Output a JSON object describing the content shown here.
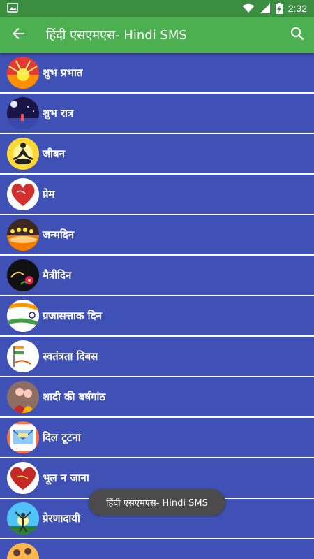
{
  "status_bar": {
    "time": "2:32",
    "icons": [
      "image-notification-icon",
      "wifi-icon",
      "signal-icon",
      "battery-charging-icon"
    ],
    "color": "#3b8e3f"
  },
  "app_bar": {
    "title": "हिंदी एसएमएस- Hindi SMS",
    "back_icon": "arrow-back-icon",
    "search_icon": "search-icon",
    "color": "#4caf50"
  },
  "list": {
    "background": "#3f51b5",
    "items": [
      {
        "label": "शुभ प्रभात",
        "icon": "sunrise-thumbnail"
      },
      {
        "label": "शुभ रात्र",
        "icon": "night-scene-thumbnail"
      },
      {
        "label": "जीबन",
        "icon": "meditation-thumbnail"
      },
      {
        "label": "प्रेम",
        "icon": "heart-thumbnail"
      },
      {
        "label": "जन्मदिन",
        "icon": "birthday-candles-thumbnail"
      },
      {
        "label": "मैत्रीदिन",
        "icon": "friendship-flower-thumbnail"
      },
      {
        "label": "प्रजासत्ताक दिन",
        "icon": "tricolor-thumbnail"
      },
      {
        "label": "स्वतंत्रता दिबस",
        "icon": "independence-thumbnail"
      },
      {
        "label": "शादी की बर्षगांठ",
        "icon": "wedding-thumbnail"
      },
      {
        "label": "दिल टूटना",
        "icon": "sms-envelope-thumbnail"
      },
      {
        "label": "भूल न जाना",
        "icon": "red-heart-thumbnail"
      },
      {
        "label": "प्रेरणादायी",
        "icon": "inspiration-thumbnail"
      },
      {
        "label": "",
        "icon": "partial-thumbnail"
      }
    ]
  },
  "toast": {
    "text": "हिंदी एसएमएस- Hindi SMS"
  }
}
